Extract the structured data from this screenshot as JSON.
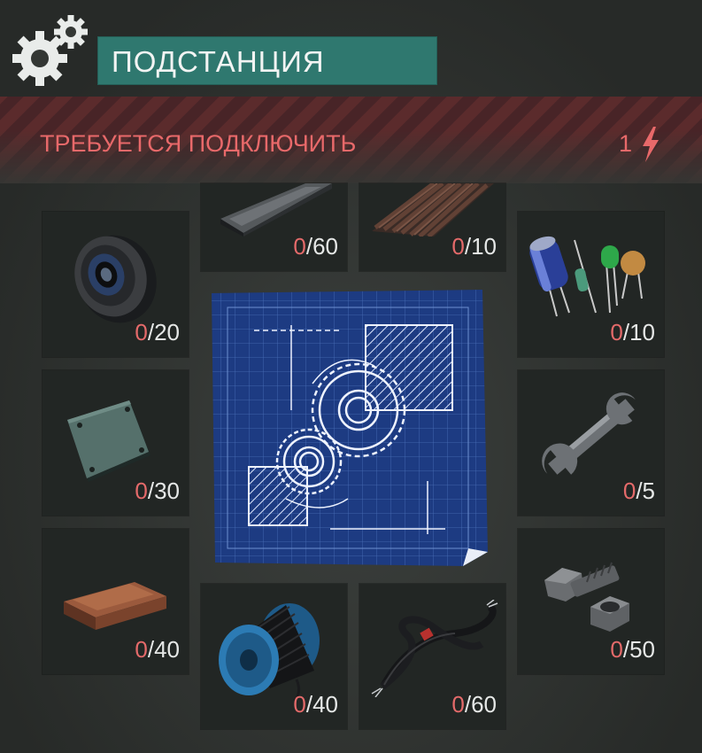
{
  "header": {
    "title": "ПОДСТАНЦИЯ",
    "icon": "gears-icon"
  },
  "requirement": {
    "label": "ТРЕБУЕТСЯ ПОДКЛЮЧИТЬ",
    "power": "1",
    "icon": "lightning-bolt-icon",
    "color": "#e8696a"
  },
  "colors": {
    "title_bg": "#2f786f",
    "warning_stripe_a": "#5b2b2c",
    "warning_stripe_b": "#482427",
    "have_count": "#e46a6a",
    "slot_bg": "#222624"
  },
  "blueprint": {
    "icon": "blueprint-gears-icon"
  },
  "materials": [
    {
      "id": "pulley",
      "icon": "pulley-icon",
      "have": "0",
      "need": "/20"
    },
    {
      "id": "metal-bar",
      "icon": "metal-bar-icon",
      "have": "0",
      "need": "/60"
    },
    {
      "id": "slate",
      "icon": "corrugated-slate-icon",
      "have": "0",
      "need": "/10"
    },
    {
      "id": "electronics",
      "icon": "capacitors-icon",
      "have": "0",
      "need": "/10"
    },
    {
      "id": "metal-plate",
      "icon": "metal-plate-icon",
      "have": "0",
      "need": "/30"
    },
    {
      "id": "wrench",
      "icon": "wrench-icon",
      "have": "0",
      "need": "/5"
    },
    {
      "id": "copper-ingot",
      "icon": "copper-ingot-icon",
      "have": "0",
      "need": "/40"
    },
    {
      "id": "wire-spool",
      "icon": "wire-spool-icon",
      "have": "0",
      "need": "/40"
    },
    {
      "id": "cable",
      "icon": "cable-icon",
      "have": "0",
      "need": "/60"
    },
    {
      "id": "bolts",
      "icon": "bolt-nut-icon",
      "have": "0",
      "need": "/50"
    }
  ]
}
